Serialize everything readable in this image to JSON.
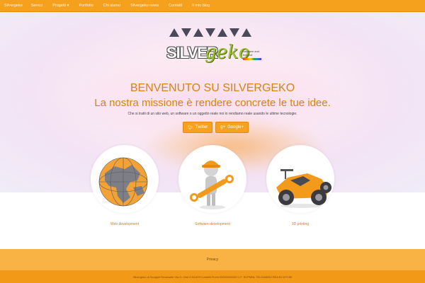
{
  "navbar": {
    "items": [
      "Silvergeko",
      "Servizi",
      "Progetti ▾",
      "Portfolio",
      "Chi siamo",
      "Silvergeko news",
      "Contatti",
      "Il mio blog"
    ]
  },
  "logo": {
    "word_silver": "SILVER",
    "word_geko": "geko",
    "tagline": "software and beyond"
  },
  "hero": {
    "welcome": "BENVENUTO SU SILVERGEKO",
    "mission": "La nostra missione è rendere concrete le tue idee.",
    "description": "Che si tratti di un sito web, un software o un oggetto reale noi lo rendiamo reale usando le ultime tecnologie."
  },
  "social": {
    "twitter_label": "Twitter",
    "google_label": "Google+"
  },
  "features": [
    {
      "label": "Web development",
      "icon": "globe-icon"
    },
    {
      "label": "Software development",
      "icon": "worker-wrench-icon"
    },
    {
      "label": "3D printing",
      "icon": "race-car-icon"
    }
  ],
  "footer": {
    "privacy": "Privacy",
    "company": "Silvergeko di Scoppel Emanuele Via G. Orsi 3 611879 Castelli Fiumi 00000000000 C.F. SCPMNL 75L10A859J REA BI 157159"
  },
  "colors": {
    "brand_orange": "#f5a11e",
    "heading_orange": "#d98213",
    "gecko_green": "#9ac531"
  }
}
